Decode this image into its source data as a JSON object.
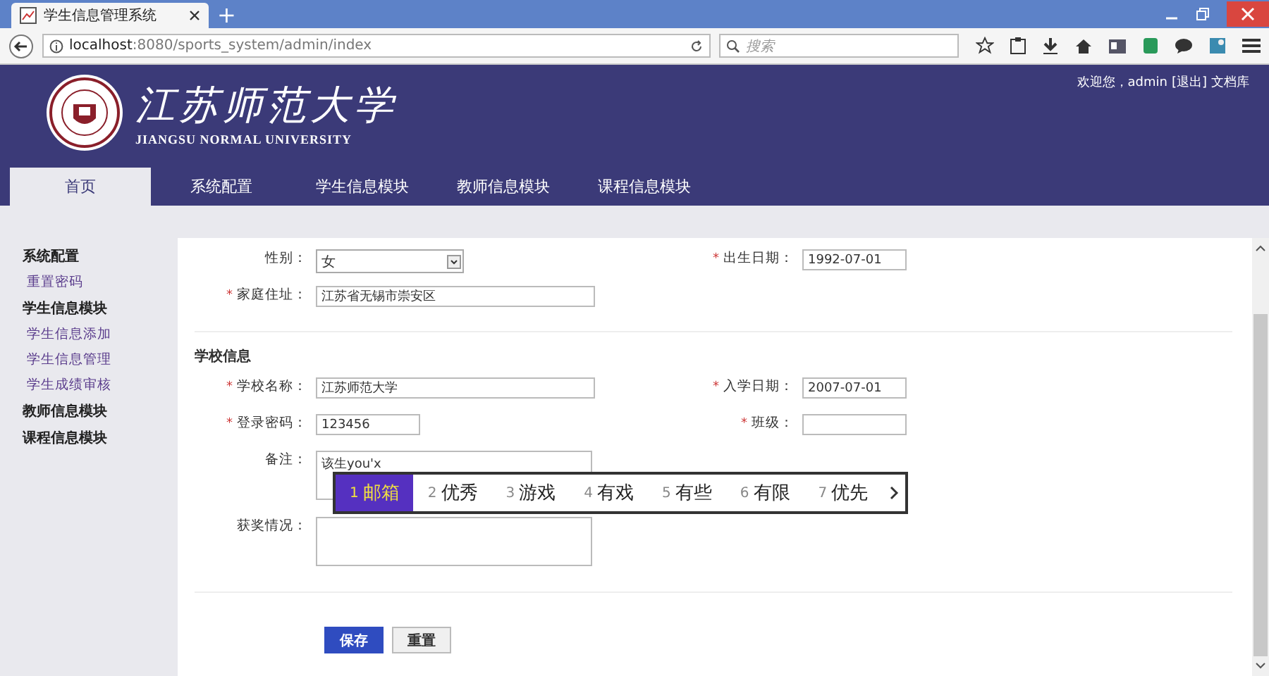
{
  "browser": {
    "tab_title": "学生信息管理系统",
    "new_tab": "+",
    "url_host": "localhost",
    "url_path": ":8080/sports_system/admin/index",
    "search_placeholder": "搜索"
  },
  "header": {
    "school_name": "江苏师范大学",
    "school_name_en": "JIANGSU NORMAL UNIVERSITY",
    "welcome": "欢迎您，admin",
    "logout": "[退出]",
    "docs": "文档库"
  },
  "nav": [
    {
      "label": "首页",
      "selected": true
    },
    {
      "label": "系统配置",
      "selected": false
    },
    {
      "label": "学生信息模块",
      "selected": false
    },
    {
      "label": "教师信息模块",
      "selected": false
    },
    {
      "label": "课程信息模块",
      "selected": false
    }
  ],
  "sidebar": [
    {
      "title": "系统配置",
      "children": [
        "重置密码"
      ]
    },
    {
      "title": "学生信息模块",
      "children": [
        "学生信息添加",
        "学生信息管理",
        "学生成绩审核"
      ]
    },
    {
      "title": "教师信息模块"
    },
    {
      "title": "课程信息模块"
    }
  ],
  "form": {
    "sections": [
      {
        "rows": [
          [
            {
              "label": "性别：",
              "kind": "select",
              "value": "女"
            },
            {
              "required_mark": "*",
              "label": "出生日期：",
              "kind": "short",
              "value": "1992-07-01"
            }
          ],
          [
            {
              "required_mark": "*",
              "label": "家庭住址：",
              "kind": "text",
              "value": "江苏省无锡市崇安区"
            }
          ]
        ]
      },
      {
        "title": "学校信息",
        "rows": [
          [
            {
              "required_mark": "*",
              "label": "学校名称：",
              "kind": "text",
              "value": "江苏师范大学"
            },
            {
              "required_mark": "*",
              "label": "入学日期：",
              "kind": "short",
              "value": "2007-07-01"
            }
          ],
          [
            {
              "required_mark": "*",
              "label": "登录密码：",
              "kind": "short",
              "value": "123456"
            },
            {
              "required_mark": "*",
              "label": "班级：",
              "kind": "short"
            }
          ],
          [
            {
              "label": "备注：",
              "kind": "textarea",
              "value": "该生you'x"
            }
          ],
          [
            {
              "label": "获奖情况：",
              "kind": "textarea"
            }
          ]
        ]
      }
    ],
    "buttons": [
      {
        "label": "保存",
        "kind": "primary"
      },
      {
        "label": "重置",
        "kind": "secondary"
      }
    ]
  },
  "ime": {
    "candidates": [
      {
        "index": "1",
        "text": "邮箱",
        "selected": true
      },
      {
        "index": "2",
        "text": "优秀",
        "selected": false
      },
      {
        "index": "3",
        "text": "游戏",
        "selected": false
      },
      {
        "index": "4",
        "text": "有戏",
        "selected": false
      },
      {
        "index": "5",
        "text": "有些",
        "selected": false
      },
      {
        "index": "6",
        "text": "有限",
        "selected": false
      },
      {
        "index": "7",
        "text": "优先",
        "selected": false
      }
    ]
  }
}
